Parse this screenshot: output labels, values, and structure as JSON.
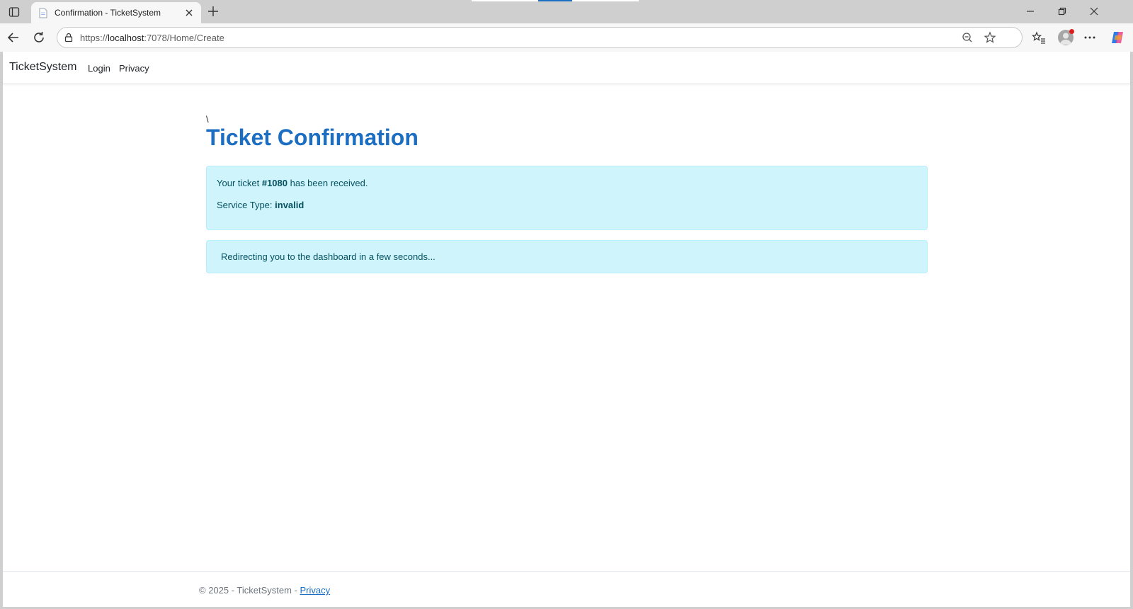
{
  "browser": {
    "tab": {
      "title": "Confirmation - TicketSystem"
    },
    "address": {
      "scheme": "https://",
      "host": "localhost",
      "path": ":7078/Home/Create"
    }
  },
  "nav": {
    "brand": "TicketSystem",
    "links": [
      "Login",
      "Privacy"
    ]
  },
  "content": {
    "backslash": "\\",
    "title": "Ticket Confirmation",
    "ticket": {
      "prefix": "Your ticket ",
      "number": "#1080",
      "suffix": " has been received.",
      "service_label": "Service Type: ",
      "service_value": "invalid"
    },
    "redirect_message": "Redirecting you to the dashboard in a few seconds..."
  },
  "footer": {
    "text": "© 2025 - TicketSystem - ",
    "link": "Privacy"
  },
  "colors": {
    "accent": "#1b6ec2",
    "alert_bg": "#cff4fc",
    "alert_border": "#b6effb",
    "alert_text": "#055160"
  }
}
